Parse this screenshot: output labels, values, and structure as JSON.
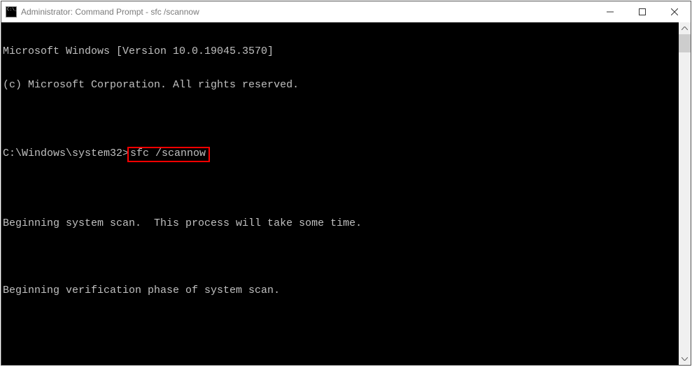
{
  "window": {
    "title": "Administrator: Command Prompt - sfc  /scannow"
  },
  "terminal": {
    "line_version": "Microsoft Windows [Version 10.0.19045.3570]",
    "line_copyright": "(c) Microsoft Corporation. All rights reserved.",
    "prompt_path": "C:\\Windows\\system32>",
    "typed_command": "sfc /scannow",
    "line_begin_scan": "Beginning system scan.  This process will take some time.",
    "line_verification": "Beginning verification phase of system scan."
  },
  "highlight": {
    "color": "#ff0000"
  }
}
